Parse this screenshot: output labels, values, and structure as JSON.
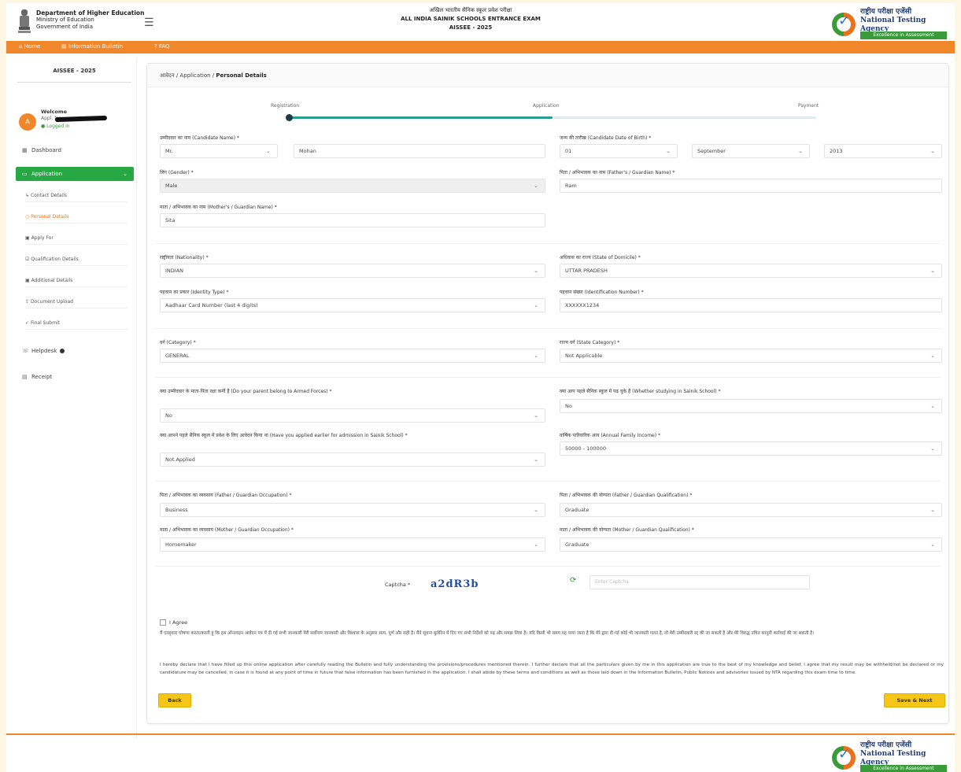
{
  "header": {
    "ministry_line1": "Department of Higher Education",
    "ministry_line2": "Ministry of Education",
    "ministry_line3": "Government of India",
    "title_hindi": "अखिल भारतीय सैनिक स्कूल प्रवेश परीक्षा",
    "title_english": "ALL INDIA SAINIK SCHOOLS ENTRANCE EXAM",
    "title_exam": "AISSEE - 2025",
    "nta_hindi": "राष्ट्रीय परीक्षा एजेंसी",
    "nta_english": "National Testing Agency",
    "nta_tagline": "Excellence in Assessment"
  },
  "nav": {
    "home": "Home",
    "info_bulletin": "Information Bulletin",
    "faq": "FAQ"
  },
  "sidebar": {
    "title": "AISSEE - 2025",
    "user_name": "Welcome",
    "user_id": "Appl. No.",
    "user_status": "Logged in",
    "avatar_letter": "A",
    "dashboard": "Dashboard",
    "application": "Application",
    "sub_items": [
      "Contact Details",
      "Personal Details",
      "Apply For",
      "Qualification Details",
      "Additional Details",
      "Document Upload",
      "Final Submit"
    ],
    "helpdesk": "Helpdesk",
    "receipt": "Receipt"
  },
  "breadcrumb": {
    "prefix": "आवेदन / Application / ",
    "current": "Personal Details"
  },
  "stepper": {
    "steps": [
      "Registration",
      "Application",
      "Payment"
    ]
  },
  "form": {
    "candidate_name_label": "उम्मीदवार का नाम (Candidate Name) *",
    "salutation": "Mr.",
    "candidate_name": "Mohan",
    "dob_label": "जन्म की तारीख (Candidate Date of Birth) *",
    "dob_day": "01",
    "dob_month": "September",
    "dob_year": "2013",
    "gender_label": "लिंग (Gender) *",
    "gender": "Male",
    "father_label": "पिता / अभिभावक का नाम (Father's / Guardian Name) *",
    "father": "Ram",
    "mother_label": "माता / अभिभावक का नाम (Mother's / Guardian Name) *",
    "mother": "Sita",
    "nationality_label": "राष्ट्रीयता (Nationality) *",
    "nationality": "INDIAN",
    "domicile_label": "अधिवास का राज्य (State of Domicile) *",
    "domicile": "UTTAR PRADESH",
    "id_type_label": "पहचान का प्रकार (Identity Type) *",
    "id_type": "Aadhaar Card Number (last 4 digits)",
    "id_number_label": "पहचान संख्या (Identification Number) *",
    "id_number": "XXXXXX1234",
    "category_label": "वर्ग (Category) *",
    "category": "GENERAL",
    "state_category_label": "राज्य वर्ग (State Category) *",
    "state_category": "Not Applicable",
    "defence_label": "क्या उम्मीदवार के माता-पिता रक्षा कर्मी हैं (Do your parent belong to Armed Forces) *",
    "defence": "No",
    "earlier_label": "क्या आप पहले सैनिक स्कूल में पढ़ चुके हैं (Whether studying in Sainik School) *",
    "earlier": "No",
    "admission_label": "क्या आपने पहले सैनिक स्कूल में प्रवेश के लिए आवेदन किया था (Have you applied earlier for admission in Sainik School) *",
    "admission": "Not Applied",
    "income_label": "वार्षिक पारिवारिक आय (Annual Family Income) *",
    "income": "50000 - 100000",
    "father_occ_label": "पिता / अभिभावक का व्यवसाय (Father / Guardian Occupation) *",
    "father_occ": "Business",
    "father_qual_label": "पिता / अभिभावक की योग्यता (Father / Guardian Qualification) *",
    "father_qual": "Graduate",
    "mother_occ_label": "माता / अभिभावक का व्यवसाय (Mother / Guardian Occupation) *",
    "mother_occ": "Homemaker",
    "mother_qual_label": "माता / अभिभावक की योग्यता (Mother / Guardian Qualification) *",
    "mother_qual": "Graduate"
  },
  "captcha": {
    "label": "Captcha *",
    "value": "a2dR3b",
    "placeholder": "Enter Captcha"
  },
  "declaration": {
    "checkbox_label": "I Agree",
    "hindi_text": "मैं एतद्द्वारा घोषणा करता/करती हूं कि इस ऑनलाइन आवेदन पत्र में दी गई सभी जानकारी मेरी सर्वोत्तम जानकारी और विश्वास के अनुसार सत्य, पूर्ण और सही है। मैंने सूचना बुलेटिन में दिए गए सभी निर्देशों को पढ़ और समझ लिया है। यदि किसी भी समय यह पाया जाता है कि मेरे द्वारा दी गई कोई भी जानकारी गलत है, तो मेरी उम्मीदवारी रद्द की जा सकती है और मेरे विरुद्ध उचित कानूनी कार्रवाई की जा सकती है।",
    "english_text": "I hereby declare that I have filled up this online application after carefully reading the Bulletin and fully understanding the provisions/procedures mentioned therein. I further declare that all the particulars given by me in this application are true to the best of my knowledge and belief. I agree that my result may be withheld/not be declared or my candidature may be cancelled, in case it is found at any point of time in future that false information has been furnished in the application. I shall abide by these terms and conditions as well as those laid down in the Information Bulletin, Public Notices and advisories issued by NTA regarding this exam time to time.",
    "back_button": "Back",
    "submit_button": "Save & Next"
  },
  "colors": {
    "accent_orange": "#f0872a",
    "active_green": "#28a745",
    "button_yellow": "#f5c518"
  }
}
